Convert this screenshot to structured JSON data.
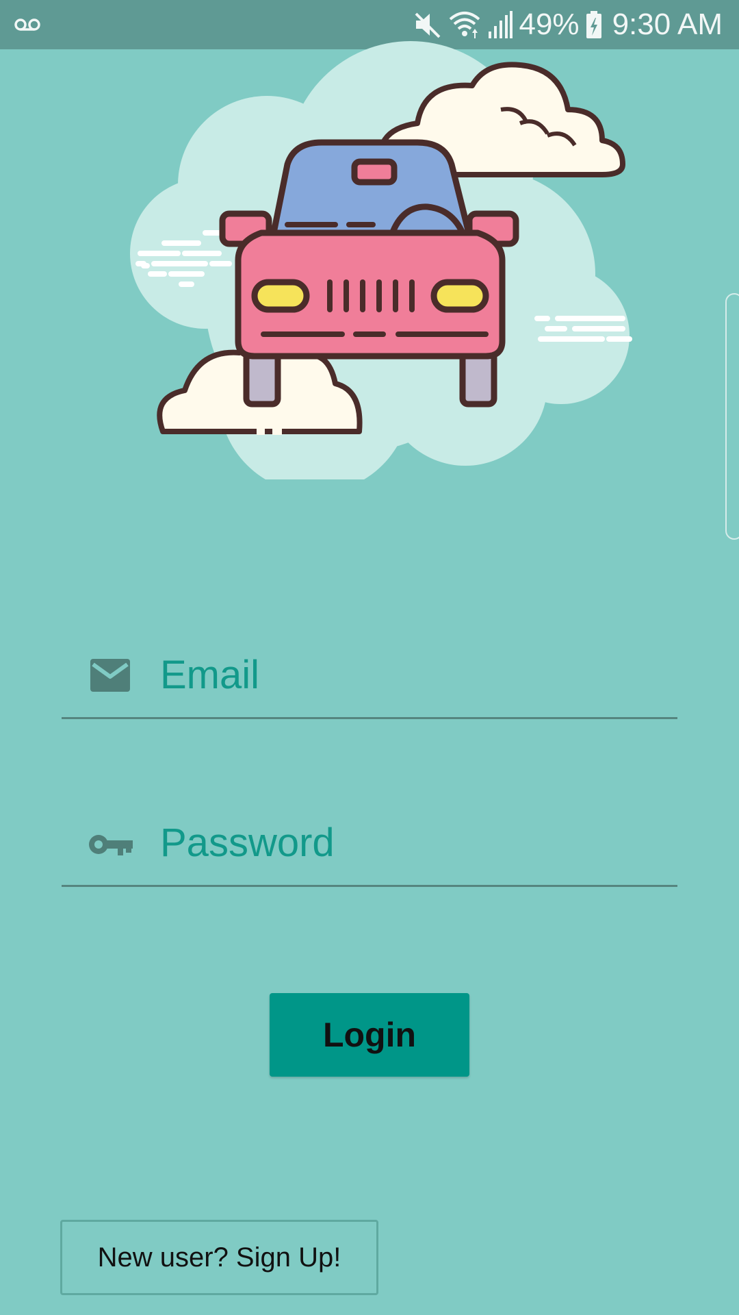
{
  "status_bar": {
    "battery": "49%",
    "time": "9:30 AM",
    "icons": [
      "voicemail-icon",
      "mute-icon",
      "wifi-icon",
      "signal-icon",
      "battery-charging-icon"
    ]
  },
  "hero": {
    "icon": "car-in-clouds-illustration"
  },
  "form": {
    "email_placeholder": "Email",
    "email_icon": "mail-icon",
    "password_placeholder": "Password",
    "password_icon": "key-icon"
  },
  "actions": {
    "login_label": "Login",
    "signup_label": "New user? Sign Up!"
  },
  "colors": {
    "background": "#80cbc4",
    "status_bar": "#5f9a94",
    "accent": "#009688",
    "input_text": "#12998a"
  }
}
